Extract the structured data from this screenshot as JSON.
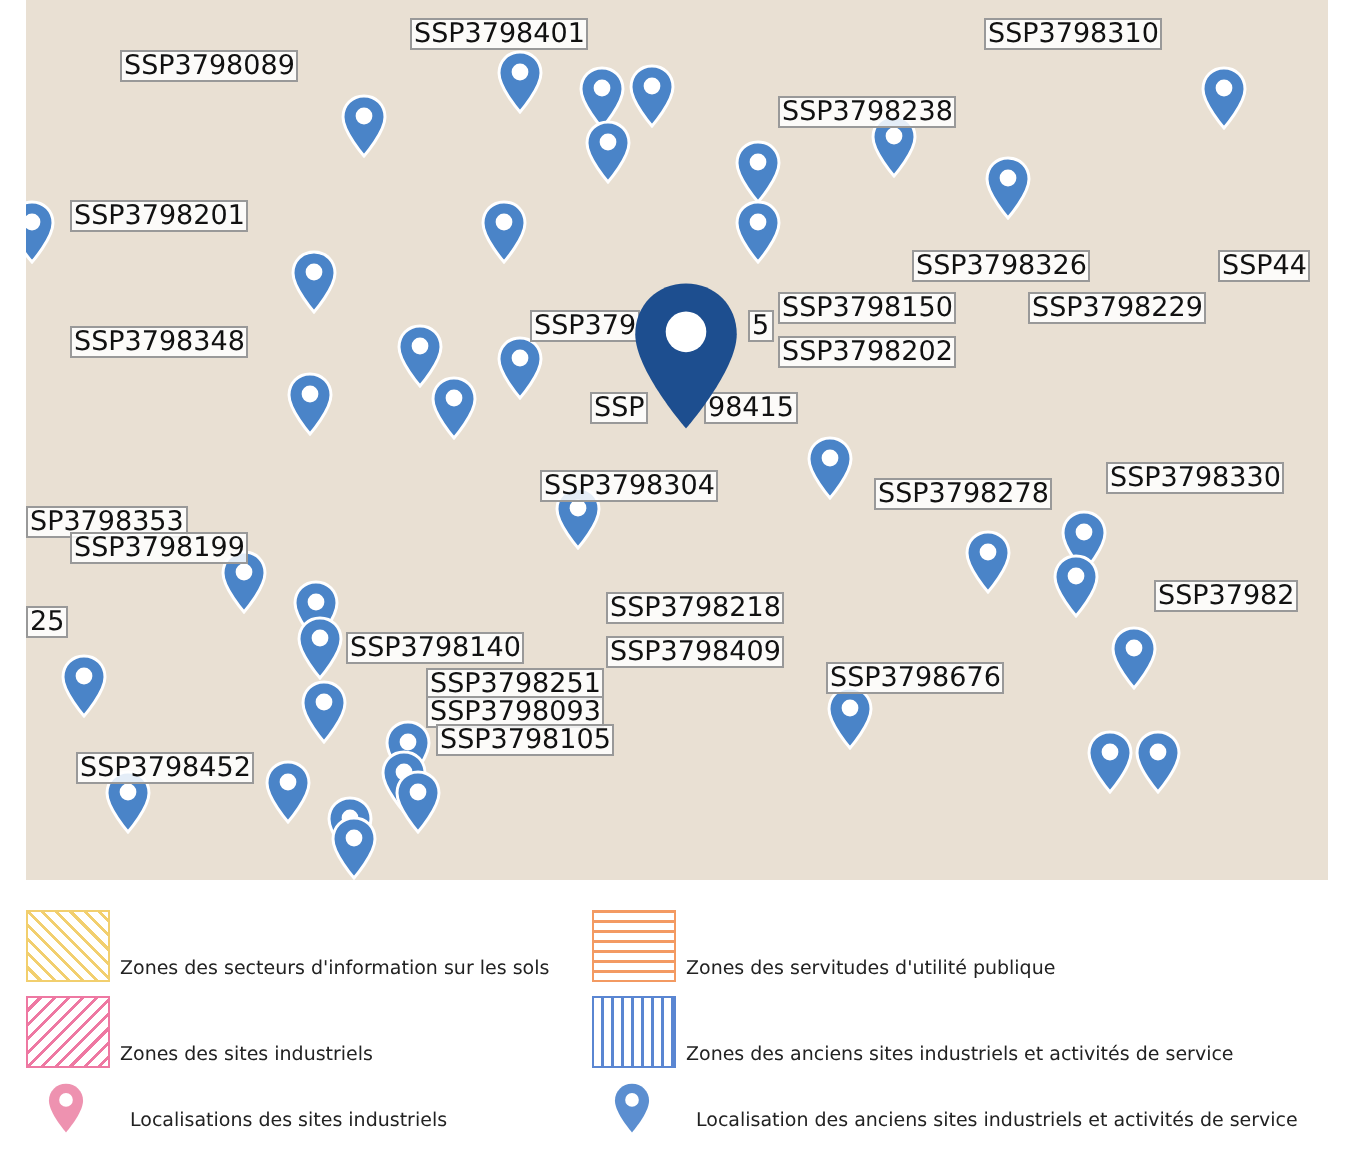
{
  "map": {
    "labels": [
      "SSP3798401",
      "SSP3798089",
      "SSP3798310",
      "SSP3798238",
      "SSP3798201",
      "SSP3798326",
      "SSP44",
      "SSP379",
      "5",
      "SSP3798150",
      "SSP3798229",
      "SSP3798348",
      "SSP3798202",
      "SSP",
      "98415",
      "SSP3798304",
      "SSP3798278",
      "SSP3798330",
      "SP3798353",
      "SSP3798199",
      "25",
      "SSP3798218",
      "SSP37982",
      "SSP3798140",
      "SSP3798409",
      "SSP3798676",
      "SSP3798251",
      "SSP3798093",
      "SSP3798105",
      "SSP3798452"
    ]
  },
  "legend": [
    {
      "kind": "diagonal",
      "color": "#f2cf6e",
      "label": "Zones des secteurs d'information sur les sols"
    },
    {
      "kind": "horizontal",
      "color": "#f39a62",
      "label": "Zones des servitudes d'utilité publique"
    },
    {
      "kind": "antidiagonal",
      "color": "#ee78a2",
      "label": "Zones des sites industriels"
    },
    {
      "kind": "vertical",
      "color": "#5a86d2",
      "label": "Zones des anciens sites industriels et activités de service"
    },
    {
      "kind": "pin",
      "color": "#ee92b0",
      "label": "Localisations des sites industriels"
    },
    {
      "kind": "pin",
      "color": "#5b8ed0",
      "label": "Localisation des anciens sites industriels et activités de service"
    }
  ]
}
